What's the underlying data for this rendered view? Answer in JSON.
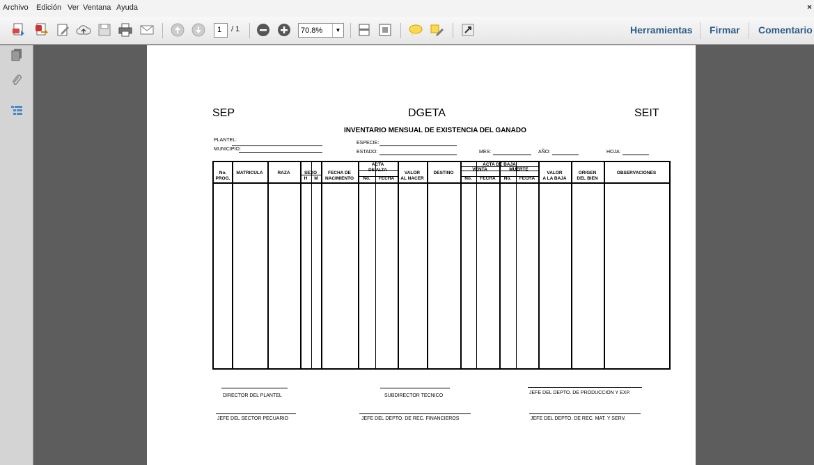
{
  "menu": {
    "items": [
      "Archivo",
      "Edición",
      "Ver",
      "Ventana",
      "Ayuda"
    ],
    "close": "×"
  },
  "toolbar": {
    "page_current": "1",
    "page_total": "/ 1",
    "zoom": "70.8%",
    "icons": [
      "create-pdf",
      "export-pdf",
      "edit-pdf",
      "upload-cloud",
      "save",
      "print",
      "email",
      "page-up",
      "page-down",
      "zoom-out",
      "zoom-in",
      "fit-width",
      "fit-page",
      "comment",
      "highlight",
      "fullscreen"
    ]
  },
  "tabs": {
    "tools": "Herramientas",
    "sign": "Firmar",
    "comment": "Comentario"
  },
  "sidebar": {
    "icons": [
      "pages-icon",
      "attachments-icon",
      "layers-icon"
    ]
  },
  "document": {
    "left_header": "SEP",
    "center_header": "DGETA",
    "right_header": "SEIT",
    "title": "INVENTARIO MENSUAL DE EXISTENCIA DEL GANADO",
    "fields": {
      "plantel": "PLANTEL:",
      "municipio": "MUNICIPIO:",
      "especie": "ESPECIE:",
      "estado": "ESTADO:",
      "mes": "MES:",
      "anio": "AÑO:",
      "hoja": "HOJA:"
    },
    "columns": {
      "no_prog": "No.\nPROG.",
      "matricula": "MATRICULA",
      "raza": "RAZA",
      "sexo": "SEXO",
      "h": "H",
      "m": "M",
      "fecha_nac": "FECHA DE\nNACIMIENTO",
      "acta_alta": "ACTA\nDE ALTA",
      "alta_no": "No.",
      "alta_fecha": "FECHA",
      "valor_nacer": "VALOR\nAL NACER",
      "destino": "DESTINO",
      "acta_baja": "ACTA DE BAJA",
      "venta": "VENTA",
      "muerte": "MUERTE",
      "venta_no": "No.",
      "venta_fecha": "FECHA",
      "muerte_no": "No.",
      "muerte_fecha": "FECHA",
      "valor_baja": "VALOR\nA LA BAJA",
      "origen": "ORIGEN\nDEL BIEN",
      "observaciones": "OBSERVACIONES"
    },
    "signatures": {
      "director": "DIRECTOR DEL PLANTEL",
      "subdirector": "SUBDIRECTOR TECNICO",
      "jefe_produccion": "JEFE DEL DEPTO. DE PRODUCCION Y EXP.",
      "jefe_pecuario": "JEFE DEL SECTOR PECUARIO",
      "jefe_financieros": "JEFE DEL DEPTO. DE REC. FINANCIEROS",
      "jefe_materiales": "JEFE DEL DEPTO. DE REC. MAT. Y SERV."
    }
  }
}
